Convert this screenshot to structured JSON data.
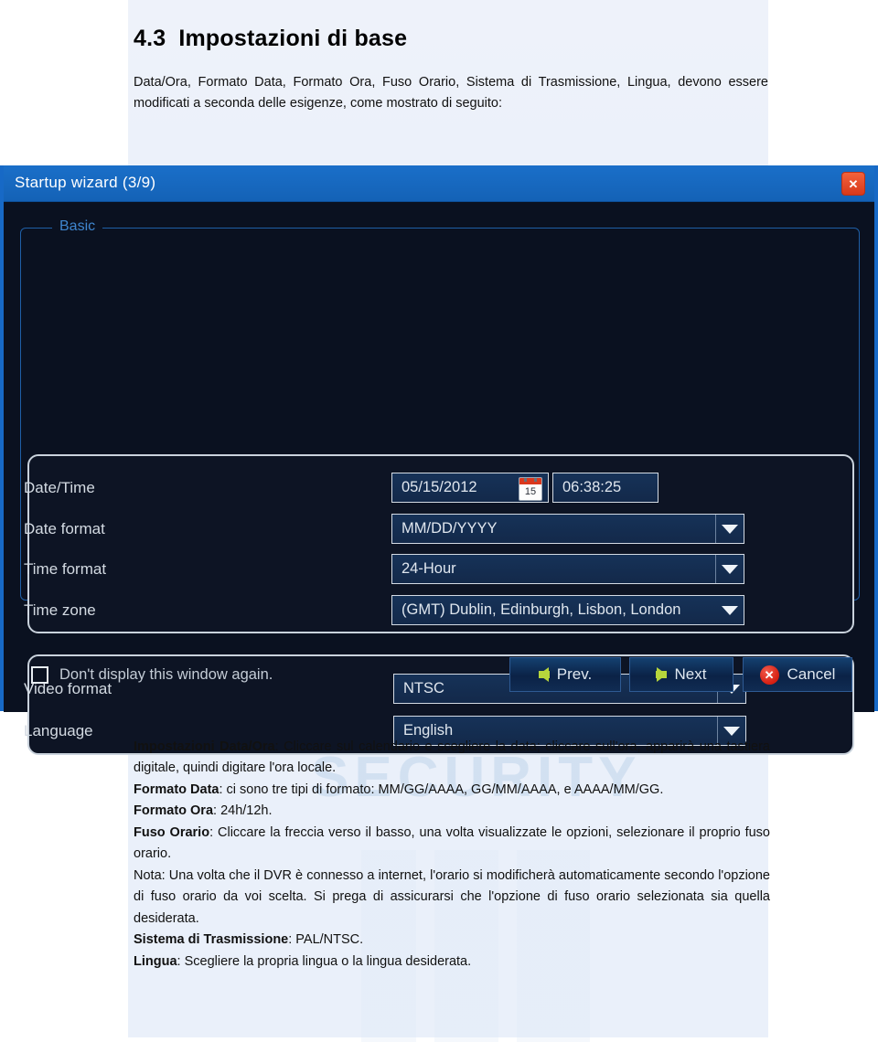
{
  "document": {
    "section_number": "4.3",
    "section_title": "Impostazioni di base",
    "intro": "Data/Ora, Formato Data, Formato Ora, Fuso Orario, Sistema di Trasmissione, Lingua, devono essere modificati a seconda delle esigenze, come mostrato di seguito:",
    "watermark": "SECURITY",
    "notes": [
      {
        "label": "Impostazioni Data/Ora",
        "text": ": Cliccare sul calendario e scegliere la data; cliccare sull'ora, apparirà una tastiera digitale, quindi digitare l'ora locale."
      },
      {
        "label": "Formato Data",
        "text": ": ci sono tre tipi di formato: MM/GG/AAAA, GG/MM/AAAA, e AAAA/MM/GG."
      },
      {
        "label": "Formato Ora",
        "text": ": 24h/12h."
      },
      {
        "label": "Fuso Orario",
        "text": ": Cliccare la freccia verso il basso, una volta visualizzate le opzioni, selezionare il proprio fuso orario."
      },
      {
        "label": "Nota",
        "text": ": Una volta che il DVR è connesso a internet, l'orario si modificherà automaticamente secondo l'opzione di fuso orario da voi scelta. Si prega di assicurarsi che l'opzione di fuso orario selezionata sia quella desiderata."
      },
      {
        "label": "Sistema di Trasmissione",
        "text": ": PAL/NTSC."
      },
      {
        "label": "Lingua",
        "text": ": Scegliere la propria lingua o la lingua desiderata."
      }
    ]
  },
  "dialog": {
    "title": "Startup wizard (3/9)",
    "close_icon": "close-x-icon",
    "group_label": "Basic",
    "fields": {
      "date_time": {
        "label": "Date/Time",
        "date_value": "05/15/2012",
        "calendar_icon": "calendar-icon",
        "calendar_day": "15",
        "time_value": "06:38:25"
      },
      "date_format": {
        "label": "Date format",
        "value": "MM/DD/YYYY",
        "arrow_icon": "chevron-down-icon"
      },
      "time_format": {
        "label": "Time format",
        "value": "24-Hour",
        "arrow_icon": "chevron-down-icon"
      },
      "time_zone": {
        "label": "Time zone",
        "value": "(GMT) Dublin, Edinburgh, Lisbon, London",
        "arrow_icon": "chevron-down-icon"
      },
      "video_format": {
        "label": "Video format",
        "value": "NTSC",
        "arrow_icon": "chevron-down-icon"
      },
      "language": {
        "label": "Language",
        "value": "English",
        "arrow_icon": "chevron-down-icon"
      }
    },
    "footer": {
      "checkbox_label": "Don't display this window again.",
      "checkbox_checked": false,
      "prev_label": "Prev.",
      "next_label": "Next",
      "cancel_label": "Cancel",
      "prev_icon": "arrow-left-icon",
      "next_icon": "arrow-right-icon",
      "cancel_icon": "cancel-x-icon"
    }
  },
  "colors": {
    "title_bar": "#1769c6",
    "dialog_bg": "#0a1120",
    "field_bg": "#163258",
    "accent_green": "#b7d63c",
    "accent_red": "#d51f12",
    "close_orange": "#e2502c",
    "group_label": "#3f86cf"
  }
}
